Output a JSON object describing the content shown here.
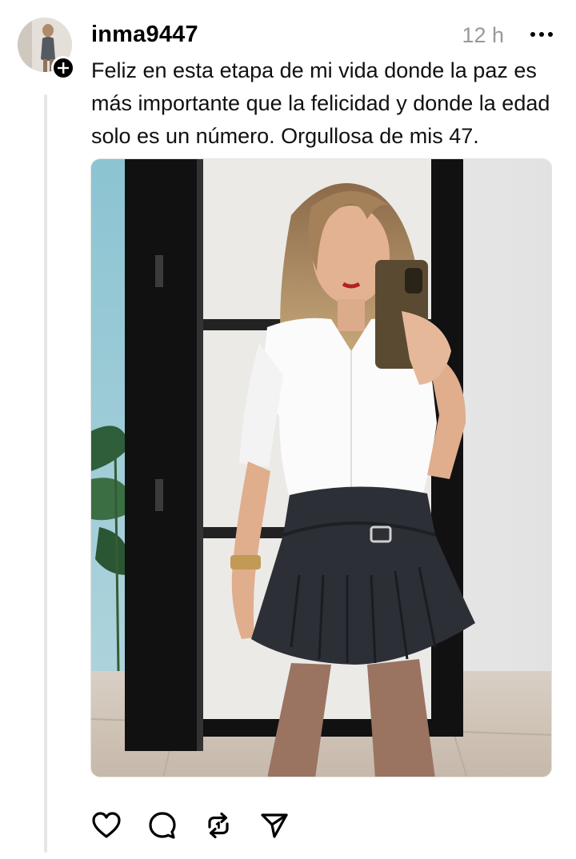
{
  "post": {
    "username": "inma9447",
    "time": "12 h",
    "caption": "Feliz en esta etapa de mi vida donde la paz es más importante que la felicidad y donde la edad solo es un número. Orgullosa de mis 47.",
    "image": "mirror-selfie-photo"
  },
  "icons": {
    "more": "more-icon",
    "follow": "plus-icon",
    "like": "heart-icon",
    "comment": "comment-icon",
    "repost": "repost-icon",
    "share": "send-icon"
  },
  "colors": {
    "text": "#000000",
    "muted": "#999999",
    "thread_line": "#e6e6e6"
  }
}
